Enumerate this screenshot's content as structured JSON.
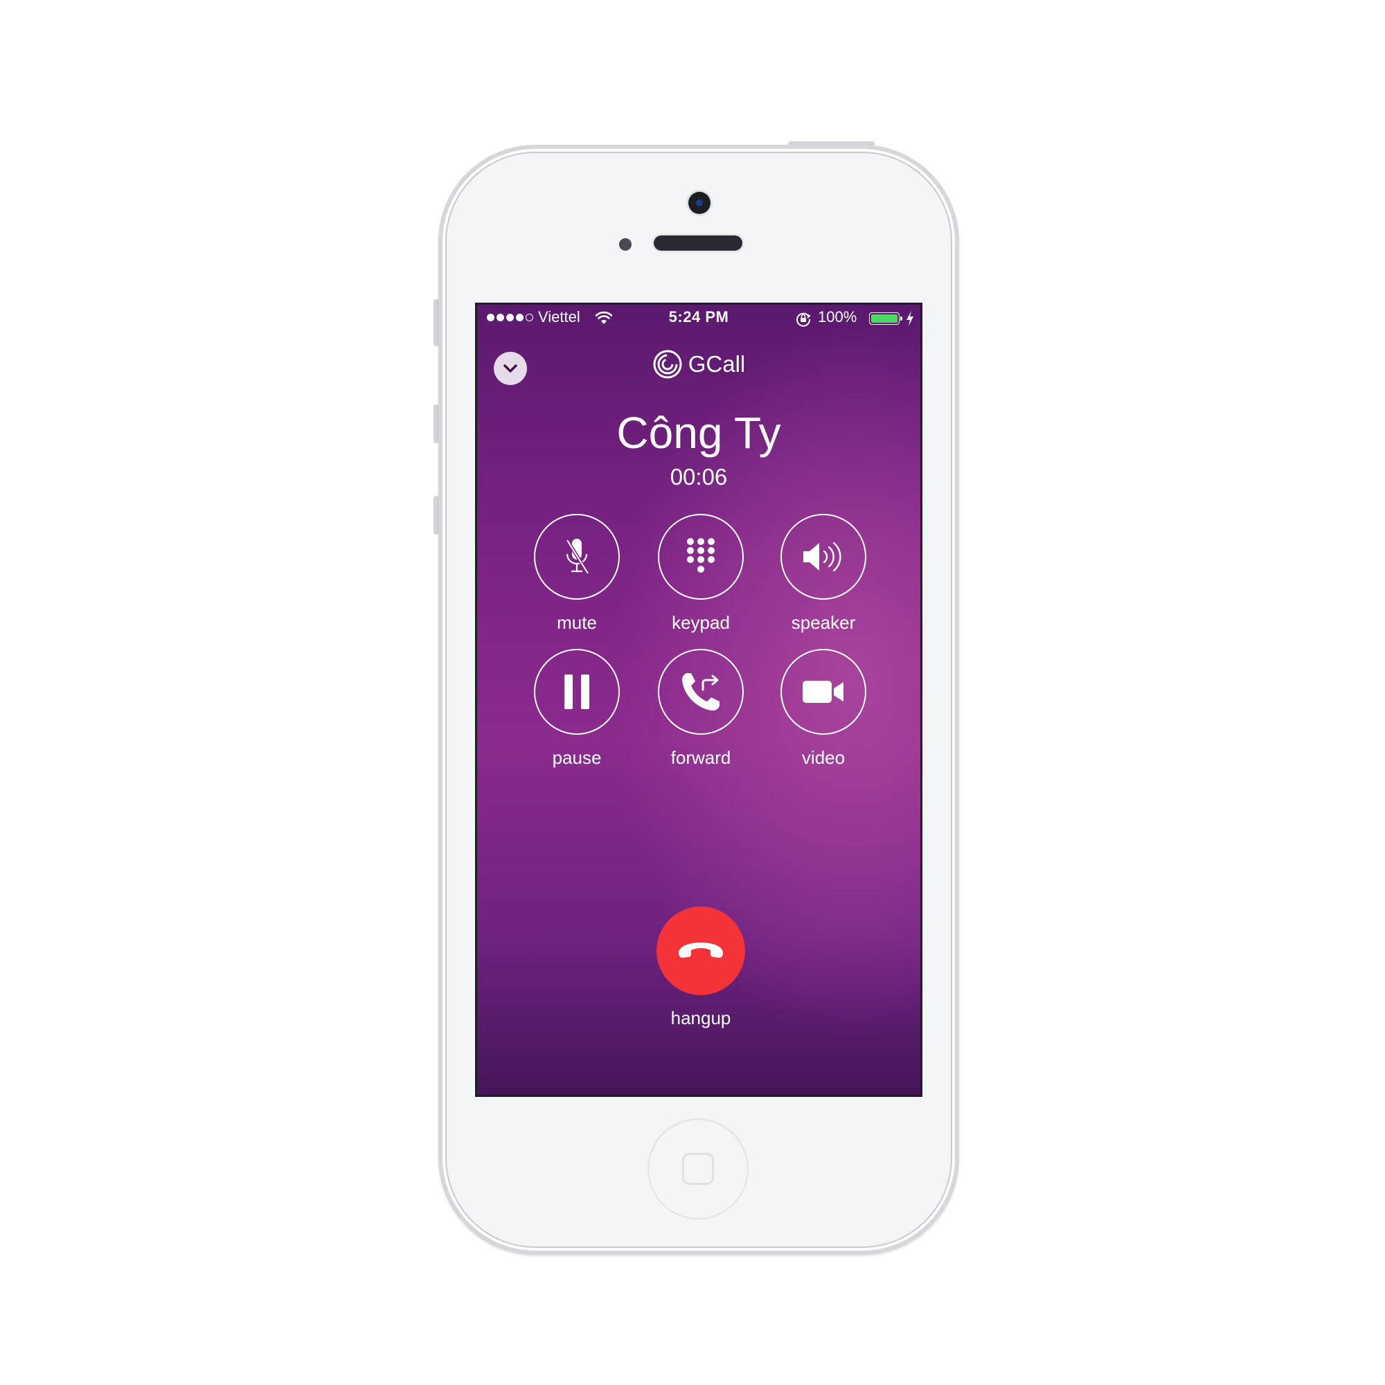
{
  "status_bar": {
    "carrier": "Viettel",
    "time": "5:24 PM",
    "battery": "100%",
    "signal_bars_filled": 4,
    "signal_bars_total": 5,
    "battery_level": 1.0,
    "icons": [
      "wifi-icon",
      "rotation-lock-icon",
      "battery-icon",
      "charging-bolt-icon"
    ]
  },
  "app": {
    "name": "GCall",
    "logo_icon": "gcall-logo-icon"
  },
  "call": {
    "caller_name": "Công Ty",
    "duration": "00:06"
  },
  "controls": [
    {
      "id": "mute",
      "label": "mute",
      "icon": "muted-microphone-icon"
    },
    {
      "id": "keypad",
      "label": "keypad",
      "icon": "keypad-icon"
    },
    {
      "id": "speaker",
      "label": "speaker",
      "icon": "speaker-icon"
    },
    {
      "id": "pause",
      "label": "pause",
      "icon": "pause-icon"
    },
    {
      "id": "forward",
      "label": "forward",
      "icon": "call-forward-icon"
    },
    {
      "id": "video",
      "label": "video",
      "icon": "video-camera-icon"
    }
  ],
  "hangup": {
    "label": "hangup",
    "icon": "end-call-icon",
    "color": "#f43338"
  },
  "colors": {
    "screen_top": "#5a1a6e",
    "screen_mid": "#8c2a8e",
    "screen_bottom": "#451558",
    "battery_fill": "#4cd964"
  }
}
